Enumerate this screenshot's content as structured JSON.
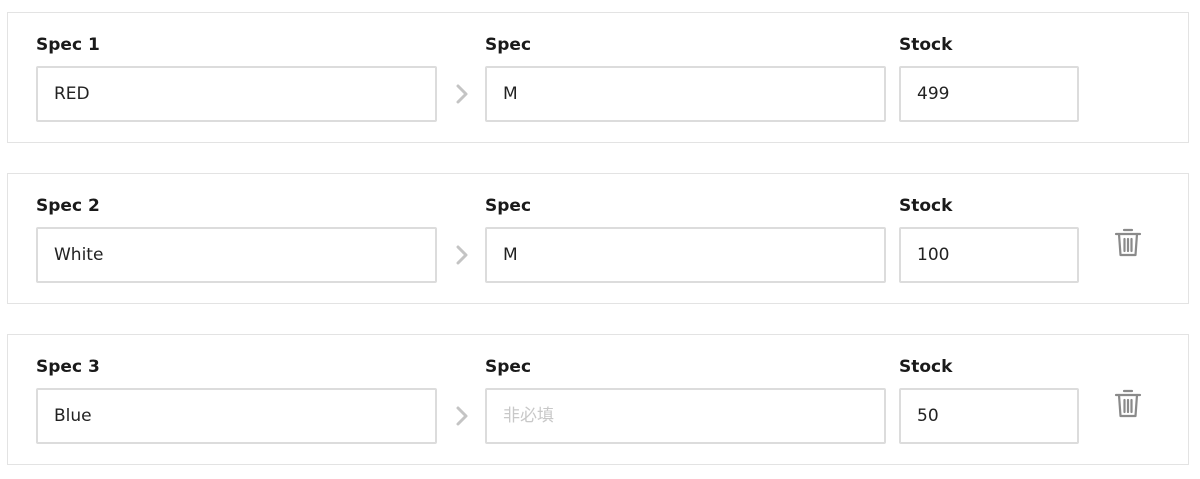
{
  "specs": [
    {
      "label": "Spec 1",
      "value": "RED",
      "spec_label": "Spec",
      "spec_value": "M",
      "spec_placeholder": "",
      "stock_label": "Stock",
      "stock_value": "499",
      "deletable": false
    },
    {
      "label": "Spec 2",
      "value": "White",
      "spec_label": "Spec",
      "spec_value": "M",
      "spec_placeholder": "",
      "stock_label": "Stock",
      "stock_value": "100",
      "deletable": true
    },
    {
      "label": "Spec 3",
      "value": "Blue",
      "spec_label": "Spec",
      "spec_value": "",
      "spec_placeholder": "非必填",
      "stock_label": "Stock",
      "stock_value": "50",
      "deletable": true
    }
  ],
  "icons": {
    "separator": "chevron-right-icon",
    "delete": "trash-icon"
  },
  "colors": {
    "border": "#e3e3e3",
    "input_border": "#dcdcdc",
    "icon": "#8a8a8a",
    "chevron": "#c4c4c4",
    "placeholder": "#c8c8c8"
  }
}
